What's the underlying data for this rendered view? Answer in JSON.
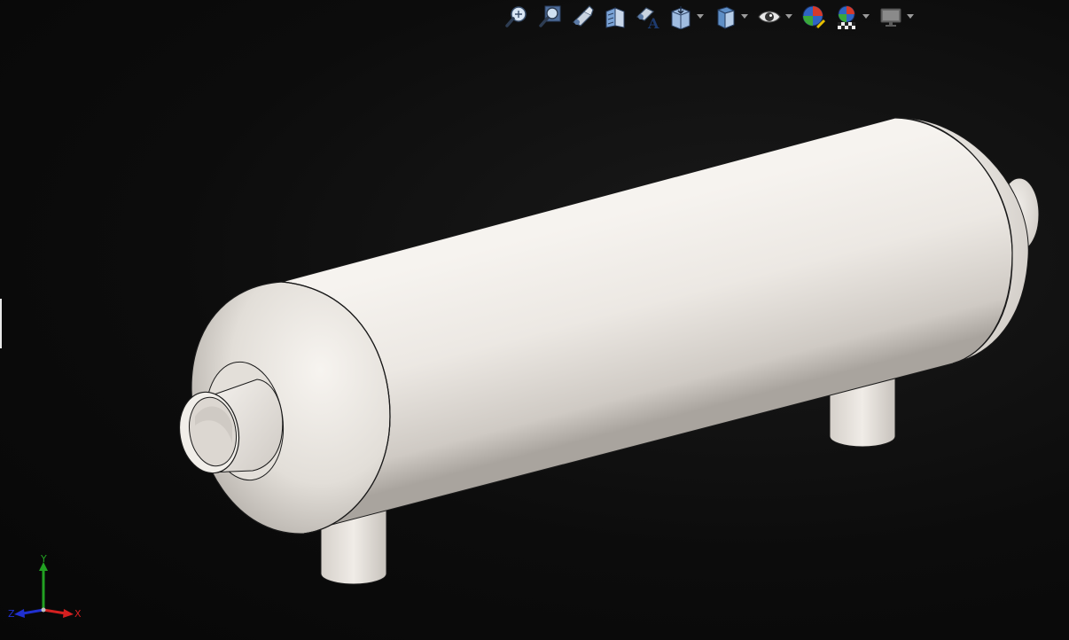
{
  "toolbar": {
    "items": [
      {
        "icon": "zoom-to-fit-icon",
        "has_dropdown": false
      },
      {
        "icon": "zoom-to-area-icon",
        "has_dropdown": false
      },
      {
        "icon": "previous-view-icon",
        "has_dropdown": false
      },
      {
        "icon": "section-view-icon",
        "has_dropdown": false
      },
      {
        "icon": "dynamic-annotation-views-icon",
        "has_dropdown": false
      },
      {
        "icon": "view-orientation-icon",
        "has_dropdown": true
      },
      {
        "icon": "display-style-icon",
        "has_dropdown": true
      },
      {
        "icon": "hide-show-items-icon",
        "has_dropdown": true
      },
      {
        "icon": "edit-appearance-icon",
        "has_dropdown": false
      },
      {
        "icon": "apply-scene-icon",
        "has_dropdown": true
      },
      {
        "icon": "view-settings-icon",
        "has_dropdown": true
      }
    ]
  },
  "triad": {
    "x_label": "X",
    "y_label": "Y",
    "z_label": "Z",
    "x_color": "#d42020",
    "y_color": "#22a022",
    "z_color": "#2030d0"
  },
  "model": {
    "name_icon": "pressure-vessel-model",
    "body_color": "#ece8e3",
    "edge_color": "#1a1a1a"
  },
  "viewport": {
    "background_color": "#0b0b0b"
  }
}
